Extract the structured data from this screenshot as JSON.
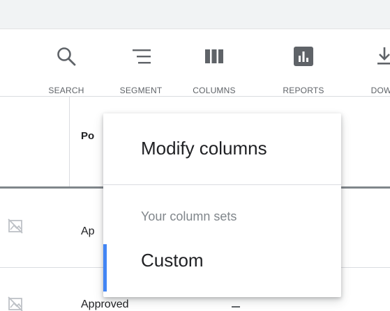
{
  "toolbar": {
    "items": [
      {
        "label": "SEARCH",
        "icon": "search-icon"
      },
      {
        "label": "SEGMENT",
        "icon": "segment-icon"
      },
      {
        "label": "COLUMNS",
        "icon": "columns-icon"
      },
      {
        "label": "REPORTS",
        "icon": "reports-icon"
      },
      {
        "label": "DOWN",
        "icon": "download-icon"
      }
    ],
    "icon_color": "#5f6368"
  },
  "table": {
    "header": {
      "column_label": "Po"
    },
    "rows": [
      {
        "status": "Ap"
      },
      {
        "status": "Approved"
      }
    ]
  },
  "dropdown": {
    "title": "Modify columns",
    "section_label": "Your column sets",
    "options": [
      {
        "label": "Custom",
        "selected": true
      }
    ],
    "accent_color": "#4285f4"
  }
}
